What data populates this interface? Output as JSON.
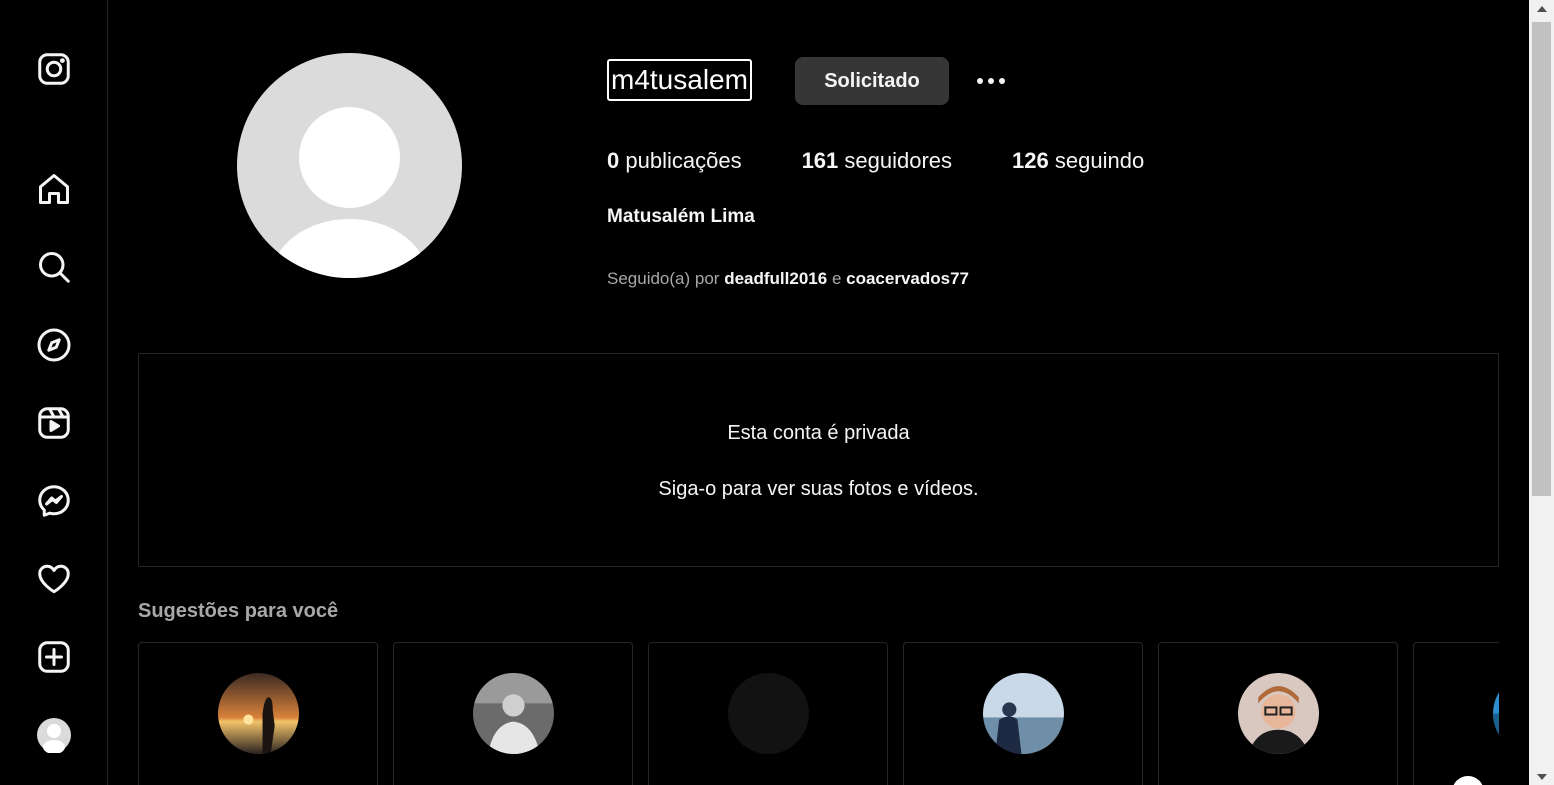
{
  "sidebar": {
    "icons": [
      "instagram-icon",
      "home-icon",
      "search-icon",
      "explore-icon",
      "reels-icon",
      "messenger-icon",
      "heart-icon",
      "create-icon",
      "profile-avatar"
    ]
  },
  "profile": {
    "username": "m4tusalem",
    "action_button": "Solicitado",
    "stats": {
      "posts_count": "0",
      "posts_label": "publicações",
      "followers_count": "161",
      "followers_label": "seguidores",
      "following_count": "126",
      "following_label": "seguindo"
    },
    "full_name": "Matusalém Lima",
    "followed_by": {
      "prefix": "Seguido(a) por",
      "user1": "deadfull2016",
      "conjunction": "e",
      "user2": "coacervados77"
    }
  },
  "private_notice": {
    "title": "Esta conta é privada",
    "subtitle": "Siga-o para ver suas fotos e vídeos."
  },
  "suggestions": {
    "title": "Sugestões para você"
  },
  "colors": {
    "background": "#000000",
    "text": "#f5f5f5",
    "secondary_text": "#a8a8a8",
    "button": "#363636",
    "border": "#262626"
  }
}
